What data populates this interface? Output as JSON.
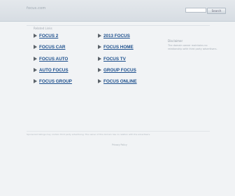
{
  "header": {
    "domain": "focus.com",
    "search_placeholder": "",
    "search_button": "Search"
  },
  "main": {
    "related_label": "Related Links",
    "links_left": [
      "FOCUS 2",
      "FOCUS CAR",
      "FOCUS AUTO",
      "AUTO FOCUS",
      "FOCUS GROUP"
    ],
    "links_right": [
      "2013 FOCUS",
      "FOCUS HOME",
      "FOCUS TV",
      "GROUP FOCUS",
      "FOCUS ONLINE"
    ]
  },
  "sidebar": {
    "title": "Disclaimer",
    "text": "The domain owner maintains no relationship with third party advertisers."
  },
  "footer": {
    "text": "Sponsored listings may contain third party advertising. The owner of this domain has no relation with the advertisers.",
    "privacy": "Privacy Policy"
  }
}
